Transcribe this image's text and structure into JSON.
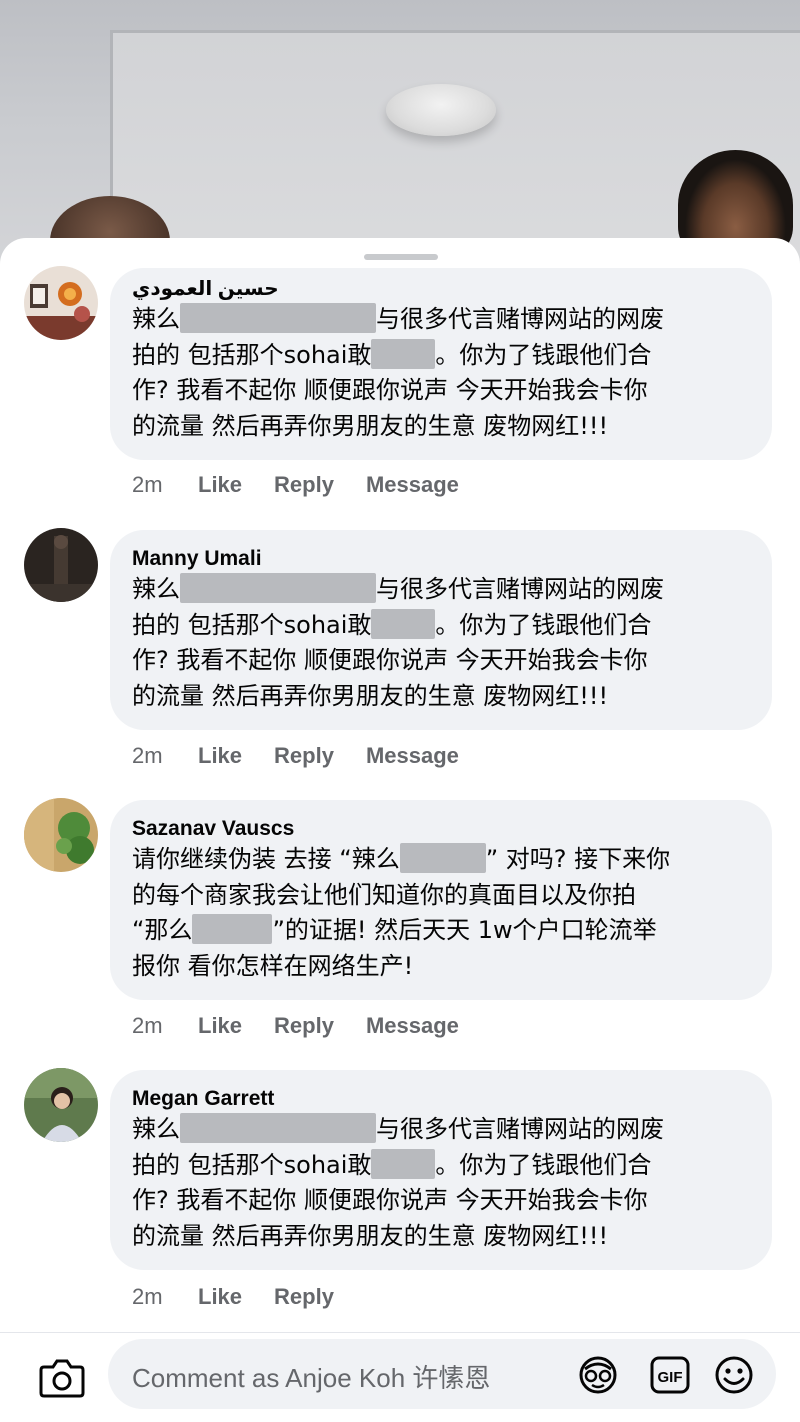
{
  "composer": {
    "placeholder": "Comment as Anjoe Koh 许愫恩"
  },
  "comments": [
    {
      "author": "حسين العمودي",
      "lines": [
        [
          "辣么",
          "",
          "与很多代言赌博网站的网废"
        ],
        [
          "拍的 包括那个sohai敢",
          "",
          "。你为了钱跟他们合"
        ],
        [
          "作? 我看不起你 顺便跟你说声 今天开始我会卡你"
        ],
        [
          "的流量 然后再弄你男朋友的生意 废物网红!!!"
        ]
      ],
      "time": "2m",
      "like": "Like",
      "reply": "Reply",
      "message": "Message"
    },
    {
      "author": "Manny Umali",
      "lines": [
        [
          "辣么",
          "",
          "与很多代言赌博网站的网废"
        ],
        [
          "拍的 包括那个sohai敢",
          "",
          "。你为了钱跟他们合"
        ],
        [
          "作? 我看不起你 顺便跟你说声 今天开始我会卡你"
        ],
        [
          "的流量 然后再弄你男朋友的生意 废物网红!!!"
        ]
      ],
      "time": "2m",
      "like": "Like",
      "reply": "Reply",
      "message": "Message"
    },
    {
      "author": "Sazanav Vauscs",
      "lines": [
        [
          "请你继续伪装 去接 “辣么",
          "",
          "” 对吗? 接下来你"
        ],
        [
          "的每个商家我会让他们知道你的真面目以及你拍"
        ],
        [
          "“那么",
          "",
          "”的证据! 然后天天 1w个户口轮流举"
        ],
        [
          "报你 看你怎样在网络生产!"
        ]
      ],
      "time": "2m",
      "like": "Like",
      "reply": "Reply",
      "message": "Message"
    },
    {
      "author": "Megan Garrett",
      "lines": [
        [
          "辣么",
          "",
          "与很多代言赌博网站的网废"
        ],
        [
          "拍的 包括那个sohai敢",
          "",
          "。你为了钱跟他们合"
        ],
        [
          "作? 我看不起你 顺便跟你说声 今天开始我会卡你"
        ],
        [
          "的流量 然后再弄你男朋友的生意 废物网红!!!"
        ]
      ],
      "time": "2m",
      "like": "Like",
      "reply": "Reply"
    }
  ]
}
